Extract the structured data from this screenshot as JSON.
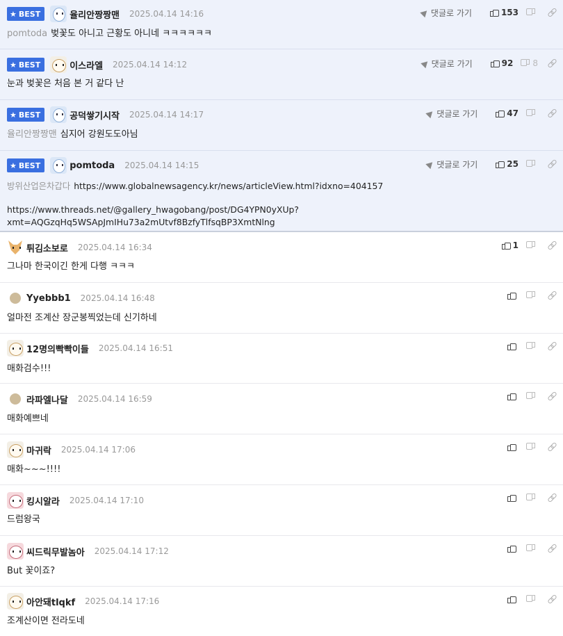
{
  "labels": {
    "best": "BEST",
    "reply": "댓글로 가기"
  },
  "colors": {
    "best_badge": "#3a6fe0",
    "best_bg": "#eef2fb"
  },
  "best_comments": [
    {
      "nick": "율리안짱짱맨",
      "date": "2025.04.14 14:16",
      "mention": "pomtoda",
      "text": "벚꽃도 아니고 근황도 아니네 ㅋㅋㅋㅋㅋㅋ",
      "up": "153",
      "down": "",
      "avatar": "av-blue"
    },
    {
      "nick": "이스라엘",
      "date": "2025.04.14 14:12",
      "mention": "",
      "text": "눈과 벚꽃은 처음 본 거 같다 난",
      "up": "92",
      "down": "8",
      "avatar": "av-dog"
    },
    {
      "nick": "공덕쌓기시작",
      "date": "2025.04.14 14:17",
      "mention": "율리안짱짱맨",
      "text": "심지어 강원도도아님",
      "up": "47",
      "down": "",
      "avatar": "av-blue"
    },
    {
      "nick": "pomtoda",
      "date": "2025.04.14 14:15",
      "mention": "방위산업은차갑다",
      "text": "https://www.globalnewsagency.kr/news/articleView.html?idxno=404157",
      "text2": "https://www.threads.net/@gallery_hwagobang/post/DG4YPN0yXUp?xmt=AQGzqHq5WSApJmIHu73a2mUtvf8BzfyTlfsqBP3XmtNlng",
      "up": "25",
      "down": "",
      "avatar": "av-blue"
    }
  ],
  "comments": [
    {
      "nick": "튀김소보로",
      "date": "2025.04.14 16:34",
      "text": "그나마 한국이긴 한게 다행 ㅋㅋㅋ",
      "up": "1",
      "avatar": "av-fox"
    },
    {
      "nick": "Yyebbb1",
      "date": "2025.04.14 16:48",
      "text": "얼마전 조계산 장군봉찍었는데 신기하네",
      "up": "",
      "avatar": "av-beige"
    },
    {
      "nick": "12명의빡빡이들",
      "date": "2025.04.14 16:51",
      "text": "매화검수!!!",
      "up": "",
      "avatar": "av-dog"
    },
    {
      "nick": "라파엘나달",
      "date": "2025.04.14 16:59",
      "text": "매화예쁘네",
      "up": "",
      "avatar": "av-beige"
    },
    {
      "nick": "마귀락",
      "date": "2025.04.14 17:06",
      "text": "매화~~~!!!!",
      "up": "",
      "avatar": "av-dog"
    },
    {
      "nick": "킹시알라",
      "date": "2025.04.14 17:10",
      "text": "드럼왕국",
      "up": "",
      "avatar": "av-pink"
    },
    {
      "nick": "씨드릭무발놈아",
      "date": "2025.04.14 17:12",
      "text": "But 꽃이죠?",
      "up": "",
      "avatar": "av-pink"
    },
    {
      "nick": "아안돼tlqkf",
      "date": "2025.04.14 17:16",
      "text": "조계산이면 전라도네",
      "up": "",
      "avatar": "av-dog"
    }
  ]
}
